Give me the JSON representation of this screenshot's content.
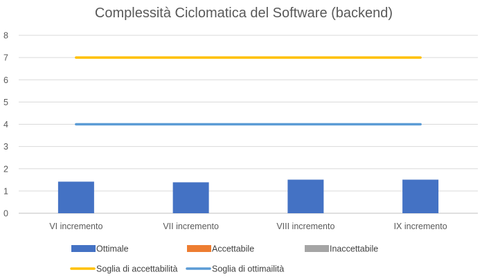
{
  "chart_data": {
    "type": "bar",
    "title": "Complessità Ciclomatica del Software (backend)",
    "categories": [
      "VI incremento",
      "VII incremento",
      "VIII incremento",
      "IX incremento"
    ],
    "ylim": [
      0,
      8
    ],
    "yticks": [
      "0",
      "1",
      "2",
      "3",
      "4",
      "5",
      "6",
      "7",
      "8"
    ],
    "grid": true,
    "legend_position": "bottom",
    "series": [
      {
        "name": "Ottimale",
        "kind": "bar",
        "color": "#4472C4",
        "values": [
          1.42,
          1.39,
          1.51,
          1.51
        ]
      },
      {
        "name": "Accettabile",
        "kind": "bar",
        "color": "#ED7D31",
        "values": [
          0,
          0,
          0,
          0
        ]
      },
      {
        "name": "Inaccettabile",
        "kind": "bar",
        "color": "#A5A5A5",
        "values": [
          0,
          0,
          0,
          0
        ]
      },
      {
        "name": "Soglia di accettabilità",
        "kind": "line",
        "color": "#FFC000",
        "values": [
          7,
          7,
          7,
          7
        ]
      },
      {
        "name": "Soglia di ottimailità",
        "kind": "line",
        "color": "#5B9BD5",
        "values": [
          4,
          4,
          4,
          4
        ]
      }
    ]
  }
}
